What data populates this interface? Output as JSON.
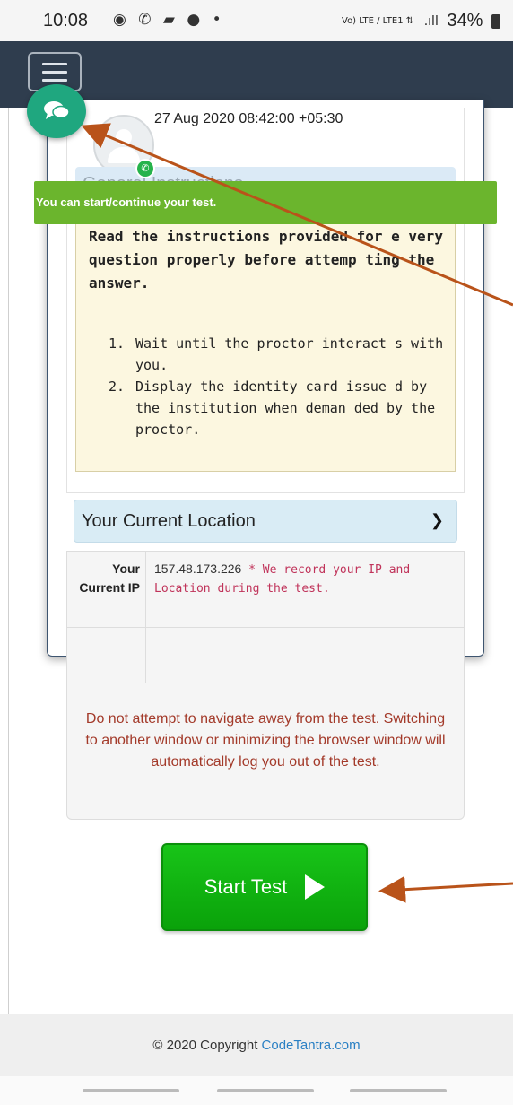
{
  "status_bar": {
    "time": "10:08",
    "app_icons": "◉ ✆ ▰ ● •",
    "network": "Vo) LTE / LTE1 ⇅",
    "signal": ".ıll",
    "battery": "34%"
  },
  "session": {
    "datetime": "27 Aug 2020 08:42:00 +05:30"
  },
  "toast": {
    "message": "You can start/continue your test."
  },
  "general_instructions": {
    "title": "General Instructions",
    "lead": "Read the instructions provided for e very question properly before attemp ting the answer.",
    "items": [
      {
        "num": "1.",
        "text": "Wait until the proctor interact s with you."
      },
      {
        "num": "2.",
        "text": "Display the identity card issue d by the institution when deman ded by the proctor."
      }
    ]
  },
  "location": {
    "title": "Your Current Location",
    "ip_label": "Your Current IP",
    "ip_value": "157.48.173.226",
    "ip_note": "* We record your IP and Location during the test."
  },
  "warning": "Do not attempt to navigate away from the test. Switching to another window or minimizing the browser window will automatically log you out of the test.",
  "start_button": {
    "label": "Start Test"
  },
  "footer": {
    "copyright": "© 2020 Copyright ",
    "brand": "CodeTantra.com"
  },
  "colors": {
    "navbar": "#2f3d4e",
    "chat": "#1fa77f",
    "toast": "#6bb52d",
    "start_button": "#12b312",
    "annotation_arrow": "#b9531a",
    "warning_text": "#a33a2a",
    "ip_note": "#c0335a",
    "brand_link": "#2a80c4"
  }
}
